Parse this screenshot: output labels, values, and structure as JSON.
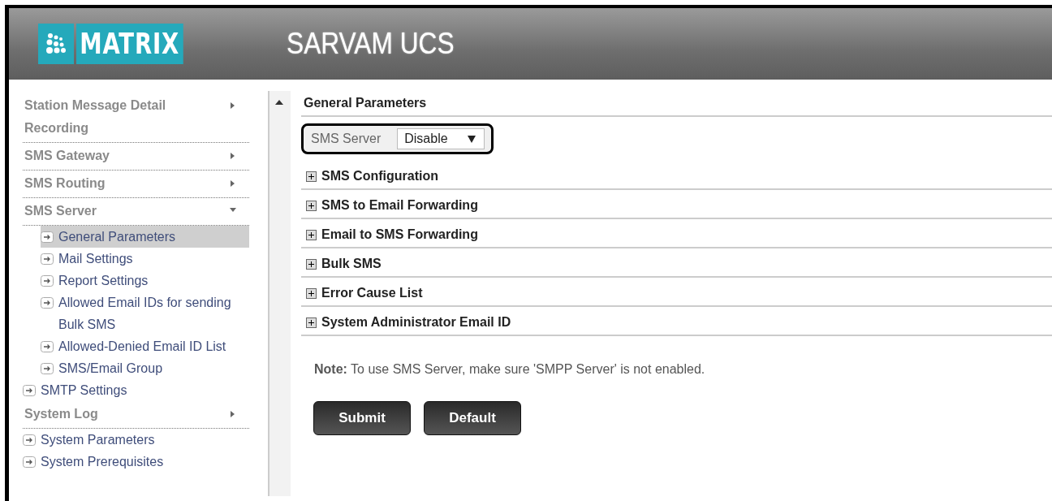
{
  "header": {
    "logo": "MATRIX",
    "title": "SARVAM UCS"
  },
  "sidebar": {
    "items": [
      {
        "kind": "menu",
        "label": "Station Message Detail Recording",
        "expanded": false
      },
      {
        "kind": "menu",
        "label": "SMS Gateway",
        "expanded": false
      },
      {
        "kind": "menu",
        "label": "SMS Routing",
        "expanded": false
      },
      {
        "kind": "menu",
        "label": "SMS Server",
        "expanded": true,
        "children": [
          {
            "kind": "link",
            "label": "General Parameters",
            "selected": true
          },
          {
            "kind": "link",
            "label": "Mail Settings",
            "selected": false
          },
          {
            "kind": "link",
            "label": "Report Settings",
            "selected": false
          },
          {
            "kind": "link",
            "label": "Allowed Email IDs for sending Bulk SMS",
            "selected": false
          },
          {
            "kind": "link",
            "label": "Allowed-Denied Email ID List",
            "selected": false
          },
          {
            "kind": "link",
            "label": "SMS/Email Group",
            "selected": false
          }
        ]
      },
      {
        "kind": "link",
        "label": "SMTP Settings",
        "selected": false
      },
      {
        "kind": "menu",
        "label": "System Log",
        "expanded": false
      },
      {
        "kind": "link",
        "label": "System Parameters",
        "selected": false
      },
      {
        "kind": "link",
        "label": "System Prerequisites",
        "selected": false
      }
    ]
  },
  "content": {
    "title": "General Parameters",
    "field": {
      "label": "SMS Server",
      "value": "Disable"
    },
    "sections": [
      {
        "label": "SMS Configuration",
        "expanded": false
      },
      {
        "label": "SMS to Email Forwarding",
        "expanded": false
      },
      {
        "label": "Email to SMS Forwarding",
        "expanded": false
      },
      {
        "label": "Bulk SMS",
        "expanded": false
      },
      {
        "label": "Error Cause List",
        "expanded": false
      },
      {
        "label": "System Administrator Email ID",
        "expanded": false
      }
    ],
    "note": "**Note:** To use SMS Server, make sure 'SMPP Server' is not enabled.",
    "buttons": [
      "Submit",
      "Default"
    ]
  }
}
